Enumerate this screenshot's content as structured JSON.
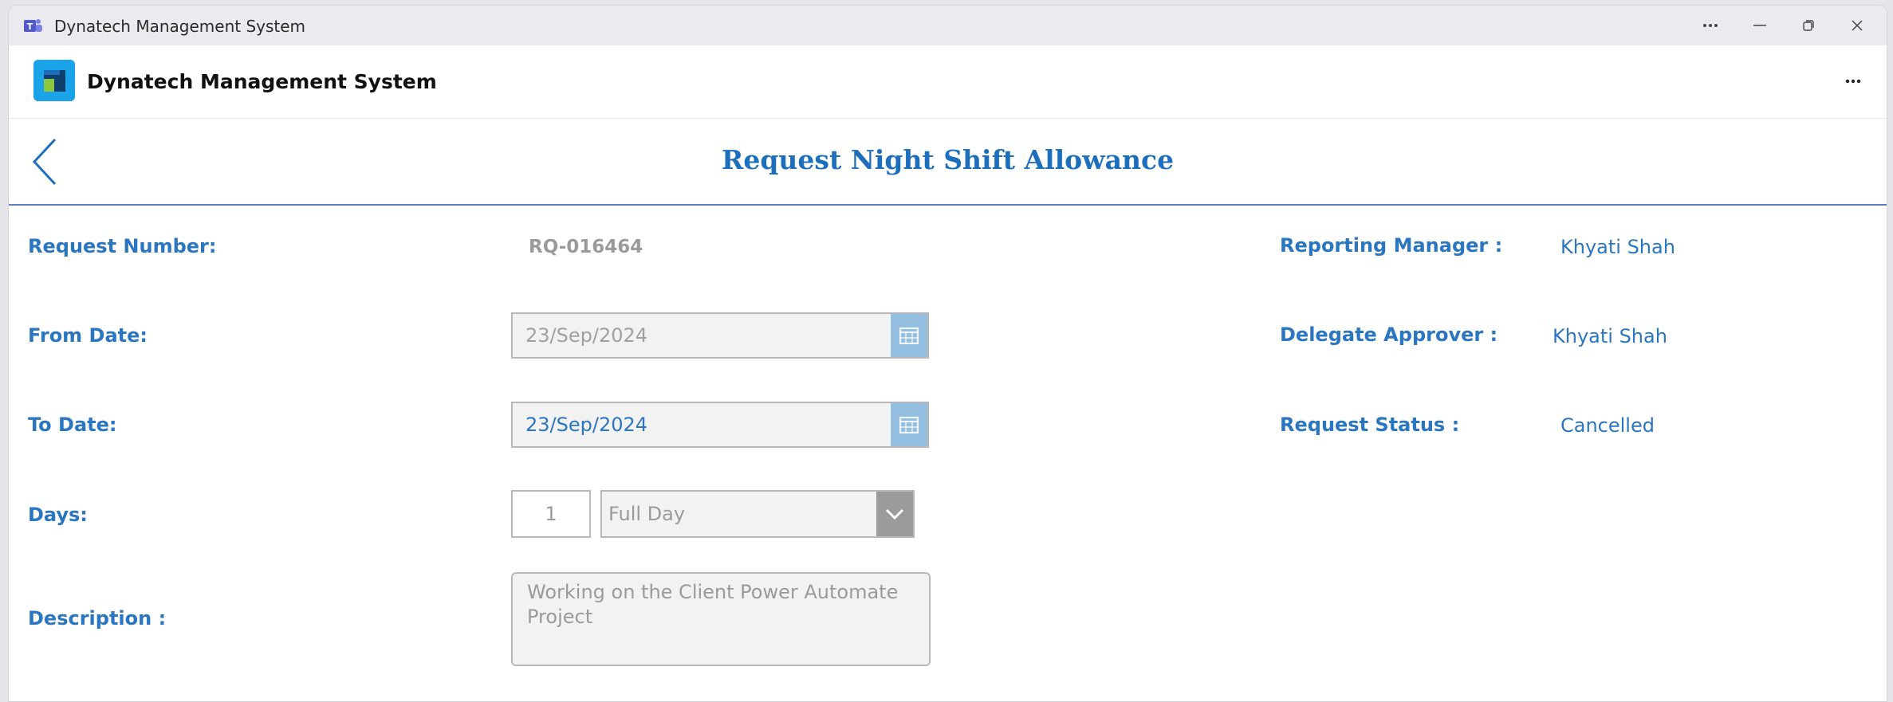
{
  "window": {
    "title": "Dynatech Management System",
    "controls": {
      "more": "...",
      "minimize": "minimize",
      "restore": "restore",
      "close": "close"
    }
  },
  "app": {
    "name": "Dynatech Management System"
  },
  "page": {
    "title": "Request Night Shift Allowance"
  },
  "form": {
    "request_number_label": "Request Number:",
    "request_number_value": "RQ-016464",
    "from_date_label": "From Date:",
    "from_date_value": "23/Sep/2024",
    "to_date_label": "To Date:",
    "to_date_value": "23/Sep/2024",
    "days_label": "Days:",
    "days_value": "1",
    "day_type_value": "Full Day",
    "description_label": "Description :",
    "description_value": "Working on the Client Power Automate Project"
  },
  "approval": {
    "reporting_manager_label": "Reporting Manager :",
    "reporting_manager_value": "Khyati Shah",
    "delegate_approver_label": "Delegate Approver :",
    "delegate_approver_value": "Khyati Shah",
    "request_status_label": "Request Status :",
    "request_status_value": "Cancelled"
  },
  "colors": {
    "accent": "#2a76c1",
    "title": "#1d6fbd",
    "calendar_button": "#94bfe0",
    "disabled_text": "#9a9a9a",
    "from_date_text": "#a0a0a0",
    "to_date_text": "#2a76c1"
  },
  "icons": [
    "teams-icon",
    "more-icon",
    "minimize-icon",
    "restore-icon",
    "close-icon",
    "app-logo",
    "back-arrow-icon",
    "calendar-icon",
    "chevron-down-icon"
  ]
}
